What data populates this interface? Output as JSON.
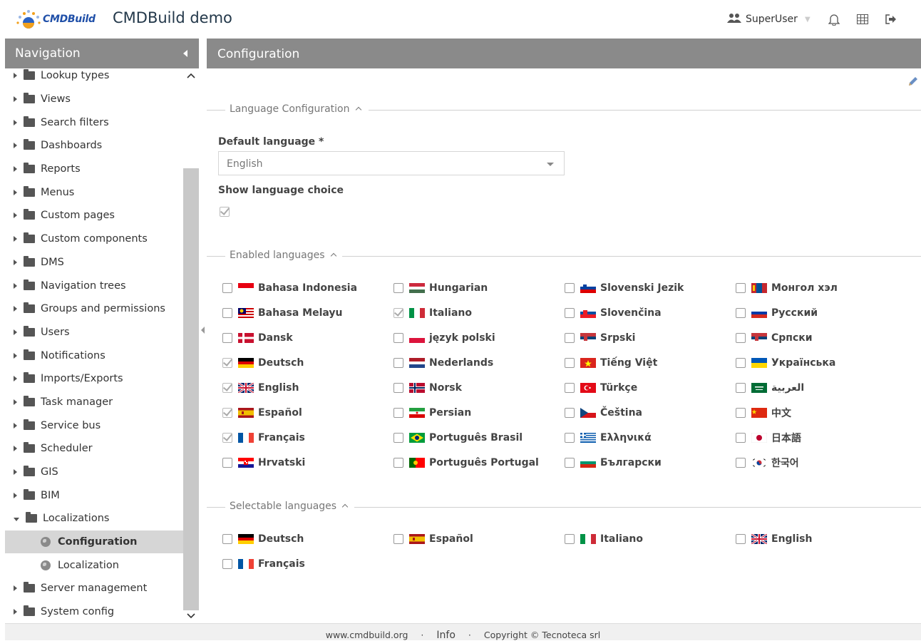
{
  "header": {
    "logo_text": "CMDBuild",
    "app_title": "CMDBuild demo",
    "user_name": "SuperUser"
  },
  "navigation": {
    "title": "Navigation",
    "items": [
      {
        "label": "Lookup types"
      },
      {
        "label": "Views"
      },
      {
        "label": "Search filters"
      },
      {
        "label": "Dashboards"
      },
      {
        "label": "Reports"
      },
      {
        "label": "Menus"
      },
      {
        "label": "Custom pages"
      },
      {
        "label": "Custom components"
      },
      {
        "label": "DMS"
      },
      {
        "label": "Navigation trees"
      },
      {
        "label": "Groups and permissions"
      },
      {
        "label": "Users"
      },
      {
        "label": "Notifications"
      },
      {
        "label": "Imports/Exports"
      },
      {
        "label": "Task manager"
      },
      {
        "label": "Service bus"
      },
      {
        "label": "Scheduler"
      },
      {
        "label": "GIS"
      },
      {
        "label": "BIM"
      },
      {
        "label": "Localizations"
      },
      {
        "label": "Configuration"
      },
      {
        "label": "Localization"
      },
      {
        "label": "Server management"
      },
      {
        "label": "System config"
      }
    ]
  },
  "main": {
    "title": "Configuration",
    "language_configuration": {
      "legend": "Language Configuration",
      "default_language_label": "Default language *",
      "default_language_value": "English",
      "show_language_choice_label": "Show language choice",
      "show_language_choice_checked": true
    },
    "enabled_languages": {
      "legend": "Enabled languages",
      "items": [
        {
          "label": "Bahasa Indonesia",
          "checked": false,
          "flag": "id-flag-icon"
        },
        {
          "label": "Hungarian",
          "checked": false,
          "flag": "hu-flag-icon"
        },
        {
          "label": "Slovenski Jezik",
          "checked": false,
          "flag": "si-flag-icon"
        },
        {
          "label": "Монгол хэл",
          "checked": false,
          "flag": "mn-flag-icon"
        },
        {
          "label": "Bahasa Melayu",
          "checked": false,
          "flag": "my-flag-icon"
        },
        {
          "label": "Italiano",
          "checked": true,
          "flag": "it-flag-icon"
        },
        {
          "label": "Slovenčina",
          "checked": false,
          "flag": "sk-flag-icon"
        },
        {
          "label": "Русский",
          "checked": false,
          "flag": "ru-flag-icon"
        },
        {
          "label": "Dansk",
          "checked": false,
          "flag": "dk-flag-icon"
        },
        {
          "label": "język polski",
          "checked": false,
          "flag": "pl-flag-icon"
        },
        {
          "label": "Srpski",
          "checked": false,
          "flag": "rs-flag-icon"
        },
        {
          "label": "Српски",
          "checked": false,
          "flag": "rs-flag-icon"
        },
        {
          "label": "Deutsch",
          "checked": true,
          "flag": "de-flag-icon"
        },
        {
          "label": "Nederlands",
          "checked": false,
          "flag": "nl-flag-icon"
        },
        {
          "label": "Tiếng Việt",
          "checked": false,
          "flag": "vn-flag-icon"
        },
        {
          "label": "Українська",
          "checked": false,
          "flag": "ua-flag-icon"
        },
        {
          "label": "English",
          "checked": true,
          "flag": "gb-flag-icon"
        },
        {
          "label": "Norsk",
          "checked": false,
          "flag": "no-flag-icon"
        },
        {
          "label": "Türkçe",
          "checked": false,
          "flag": "tr-flag-icon"
        },
        {
          "label": "العربية",
          "checked": false,
          "flag": "sa-flag-icon"
        },
        {
          "label": "Español",
          "checked": true,
          "flag": "es-flag-icon"
        },
        {
          "label": "Persian",
          "checked": false,
          "flag": "ir-flag-icon"
        },
        {
          "label": "Čeština",
          "checked": false,
          "flag": "cz-flag-icon"
        },
        {
          "label": "中文",
          "checked": false,
          "flag": "cn-flag-icon"
        },
        {
          "label": "Français",
          "checked": true,
          "flag": "fr-flag-icon"
        },
        {
          "label": "Português Brasil",
          "checked": false,
          "flag": "br-flag-icon"
        },
        {
          "label": "Ελληνικά",
          "checked": false,
          "flag": "gr-flag-icon"
        },
        {
          "label": "日本語",
          "checked": false,
          "flag": "jp-flag-icon"
        },
        {
          "label": "Hrvatski",
          "checked": false,
          "flag": "hr-flag-icon"
        },
        {
          "label": "Português Portugal",
          "checked": false,
          "flag": "pt-flag-icon"
        },
        {
          "label": "Български",
          "checked": false,
          "flag": "bg-flag-icon"
        },
        {
          "label": "한국어",
          "checked": false,
          "flag": "kr-flag-icon"
        }
      ]
    },
    "selectable_languages": {
      "legend": "Selectable languages",
      "items": [
        {
          "label": "Deutsch",
          "checked": false,
          "flag": "de-flag-icon"
        },
        {
          "label": "Español",
          "checked": false,
          "flag": "es-flag-icon"
        },
        {
          "label": "Italiano",
          "checked": false,
          "flag": "it-flag-icon"
        },
        {
          "label": "English",
          "checked": false,
          "flag": "gb-flag-icon"
        },
        {
          "label": "Français",
          "checked": false,
          "flag": "fr-flag-icon"
        }
      ]
    }
  },
  "footer": {
    "website": "www.cmdbuild.org",
    "separator": "·",
    "info": "Info",
    "copyright": "Copyright © Tecnoteca srl"
  },
  "colors": {
    "panel_header": "#8a8a8a",
    "selected_row": "#d6d6d6",
    "title_text": "#23384a",
    "logo_blue": "#1f4fa8"
  }
}
